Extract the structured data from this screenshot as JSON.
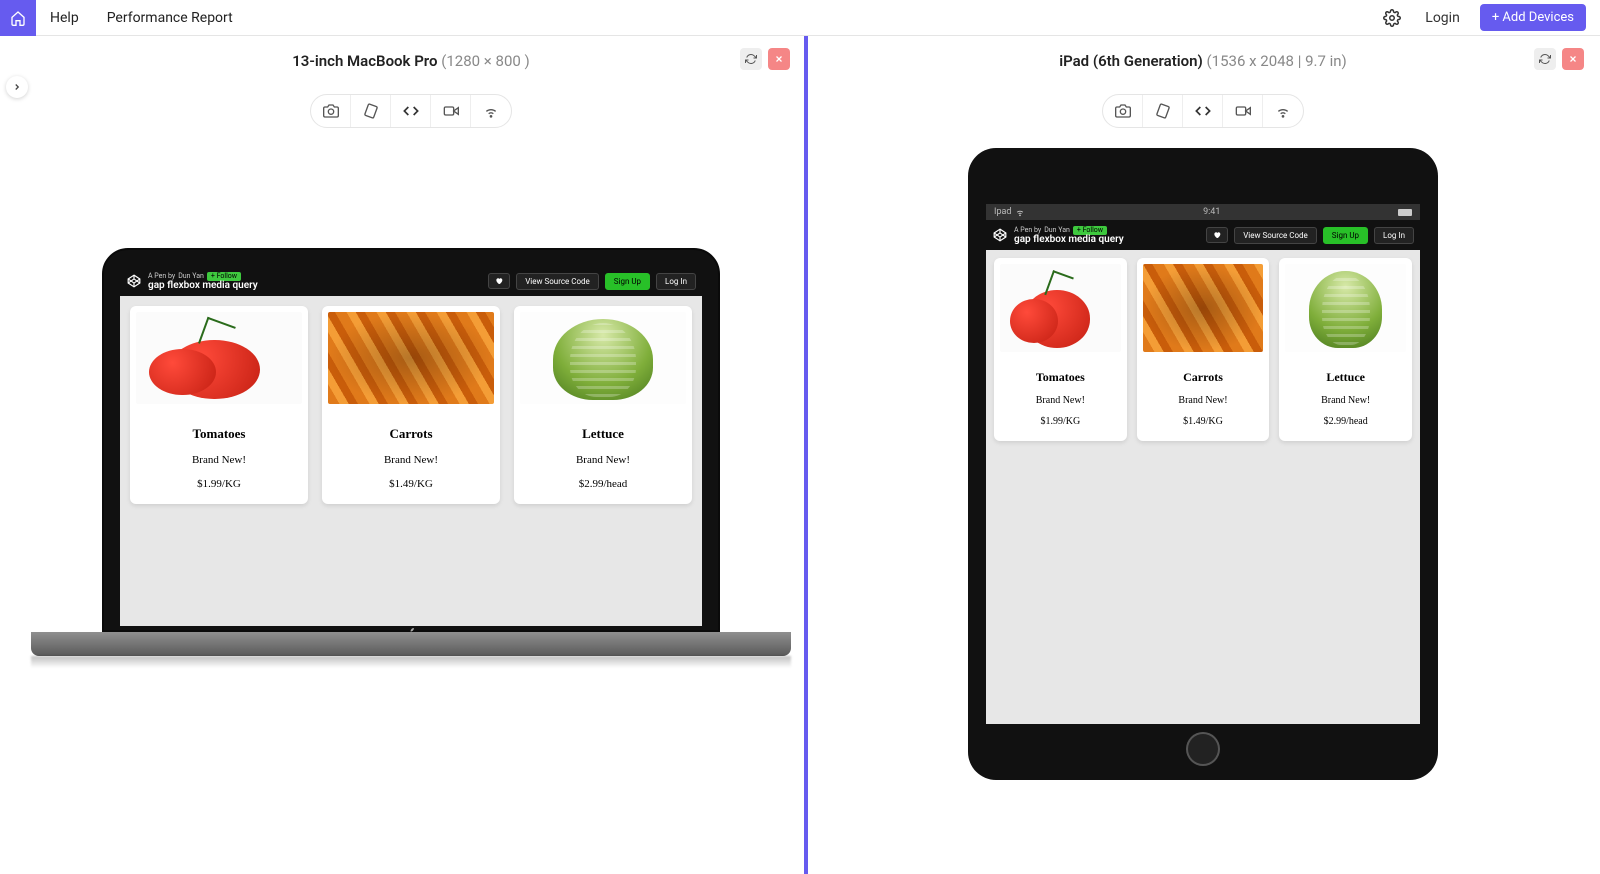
{
  "topbar": {
    "help": "Help",
    "performance": "Performance Report",
    "login": "Login",
    "add_devices": "+ Add Devices"
  },
  "devices": {
    "left": {
      "name": "13-inch MacBook Pro",
      "dims": "(1280 × 800 )"
    },
    "right": {
      "name": "iPad (6th Generation)",
      "dims": "(1536 x 2048 | 9.7 in)"
    }
  },
  "ipad_status": {
    "label": "Ipad",
    "time": "9:41"
  },
  "codepen": {
    "author_prefix": "A Pen by",
    "author": "Dun Yan",
    "follow": "+ Follow",
    "title": "gap flexbox media query",
    "view_source": "View Source Code",
    "signup": "Sign Up",
    "login": "Log In"
  },
  "products": [
    {
      "name": "Tomatoes",
      "tag": "Brand New!",
      "price": "$1.99/KG"
    },
    {
      "name": "Carrots",
      "tag": "Brand New!",
      "price": "$1.49/KG"
    },
    {
      "name": "Lettuce",
      "tag": "Brand New!",
      "price": "$2.99/head"
    }
  ]
}
